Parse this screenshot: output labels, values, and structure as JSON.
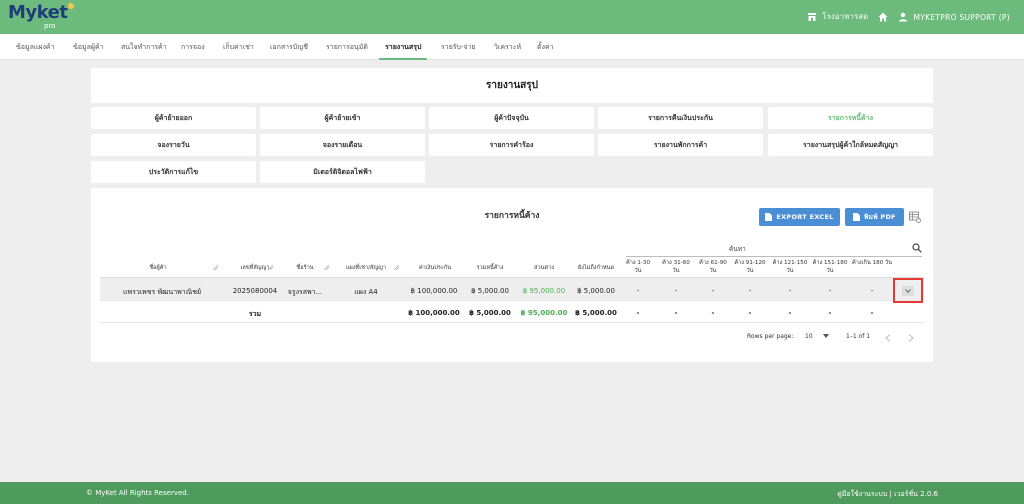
{
  "app": {
    "logo_text": "Myket",
    "logo_sub": "pro"
  },
  "header": {
    "shop_label": "โรงอาหารสด",
    "user_label": "MYKETPRO SUPPORT (P)"
  },
  "nav": {
    "items": [
      {
        "label": "ข้อมูลแผงค้า"
      },
      {
        "label": "ข้อมูลผู้ค้า"
      },
      {
        "label": "สนใจทำการค้า"
      },
      {
        "label": "การจอง"
      },
      {
        "label": "เก็บค่าเช่า"
      },
      {
        "label": "เอกสารบัญชี"
      },
      {
        "label": "รายการอนุมัติ"
      },
      {
        "label": "รายงานสรุป"
      },
      {
        "label": "รายรับ-จ่าย"
      },
      {
        "label": "วิเคราะห์"
      },
      {
        "label": "ตั้งค่า"
      }
    ],
    "active_index": 7
  },
  "report": {
    "title": "รายงานสรุป",
    "buttons": [
      {
        "label": "ผู้ค้าย้ายออก"
      },
      {
        "label": "ผู้ค้าย้ายเข้า"
      },
      {
        "label": "ผู้ค้าปัจจุบัน"
      },
      {
        "label": "รายการคืนเงินประกัน"
      },
      {
        "label": "รายการหนี้ค้าง"
      },
      {
        "label": "จองรายวัน"
      },
      {
        "label": "จองรายเดือน"
      },
      {
        "label": "รายการคำร้อง"
      },
      {
        "label": "รายงานพักการค้า"
      },
      {
        "label": "รายงานสรุปผู้ค้าใกล้หมดสัญญา"
      },
      {
        "label": "ประวัติการแก้ไข"
      },
      {
        "label": "มิเตอร์ดิจิตอลไฟฟ้า"
      }
    ],
    "active_index": 4
  },
  "card": {
    "title": "รายการหนี้ค้าง",
    "export_excel_label": "EXPORT EXCEL",
    "print_pdf_label": "พิมพ์ PDF",
    "search_label": "ค้นหา"
  },
  "table": {
    "headers": [
      "ชื่อผู้ค้า",
      "เลขที่สัญญา",
      "ชื่อร้าน",
      "แผงที่เช่า/สัญญา",
      "ค่าเงินประกัน",
      "รวมหนี้ค้าง",
      "ส่วนต่าง",
      "ยังไม่ถึงกำหนด",
      "ค้าง 1-30 วัน",
      "ค้าง 31-60 วัน",
      "ค้าง 61-90 วัน",
      "ค้าง 91-120 วัน",
      "ค้าง 121-150 วัน",
      "ค้าง 151-180 วัน",
      "ค้างเกิน 180 วัน"
    ],
    "row": {
      "name": "แพรวเพชร พัฒนาพาณิชย์",
      "contract": "2025080004",
      "shop": "จรูงรสพา...",
      "stall": "แผง A4",
      "deposit": "฿ 100,000.00",
      "total_debt": "฿ 5,000.00",
      "difference": "฿ 95,000.00",
      "not_due": "฿ 5,000.00",
      "d1_30": "-",
      "d31_60": "-",
      "d61_90": "-",
      "d91_120": "-",
      "d121_150": "-",
      "d151_180": "-",
      "d180_plus": "-"
    },
    "total": {
      "label": "รวม",
      "deposit": "฿ 100,000.00",
      "total_debt": "฿ 5,000.00",
      "difference": "฿ 95,000.00",
      "not_due": "฿ 5,000.00",
      "d1_30": "-",
      "d31_60": "-",
      "d61_90": "-",
      "d91_120": "-",
      "d121_150": "-",
      "d151_180": "-",
      "d180_plus": "-"
    }
  },
  "pagination": {
    "rows_per_page_label": "Rows per page:",
    "rows_per_page_value": "10",
    "range": "1–1 of 1"
  },
  "footer": {
    "copyright": "© MyKet All Rights Reserved.",
    "right_text": "คู่มือใช้งานระบบ | เวอร์ชั่น 2.0.6"
  },
  "colors": {
    "brand_green": "#6dbb7c",
    "footer_green": "#4e9b5d",
    "button_blue": "#4a8fd6",
    "highlight_red": "#e53935",
    "positive_green": "#4caf50"
  }
}
